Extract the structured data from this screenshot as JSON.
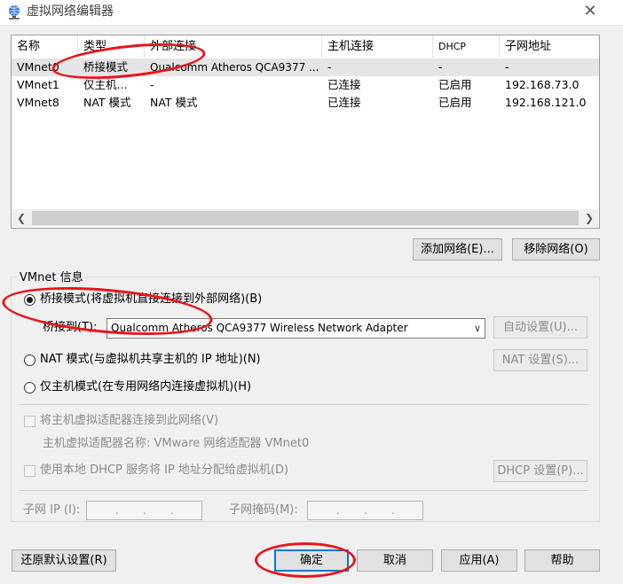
{
  "window": {
    "title": "虚拟网络编辑器",
    "close_glyph": "✕"
  },
  "table": {
    "columns": [
      "名称",
      "类型",
      "外部连接",
      "主机连接",
      "DHCP",
      "子网地址"
    ],
    "rows": [
      [
        "VMnet0",
        "桥接模式",
        "Qualcomm Atheros QCA9377 ...",
        "-",
        "-",
        "-"
      ],
      [
        "VMnet1",
        "仅主机...",
        "-",
        "已连接",
        "已启用",
        "192.168.73.0"
      ],
      [
        "VMnet8",
        "NAT 模式",
        "NAT 模式",
        "已连接",
        "已启用",
        "192.168.121.0"
      ]
    ],
    "selected_row": 0
  },
  "list_buttons": {
    "add": "添加网络(E)...",
    "remove": "移除网络(O)"
  },
  "vmnet_info": {
    "label": "VMnet 信息",
    "bridge_radio": "桥接模式(将虚拟机直接连接到外部网络)(B)",
    "bridge_to_label": "桥接到(T):",
    "bridge_adapter": "Qualcomm Atheros QCA9377 Wireless Network Adapter",
    "auto_settings": "自动设置(U)...",
    "nat_radio": "NAT 模式(与虚拟机共享主机的 IP 地址)(N)",
    "nat_settings": "NAT 设置(S)...",
    "hostonly_radio": "仅主机模式(在专用网络内连接虚拟机)(H)",
    "connect_adapter": "将主机虚拟适配器连接到此网络(V)",
    "adapter_name": "主机虚拟适配器名称: VMware 网络适配器 VMnet0",
    "use_dhcp": "使用本地 DHCP 服务将 IP 地址分配给虚拟机(D)",
    "dhcp_settings": "DHCP 设置(P)...",
    "subnet_ip_label": "子网 IP (I):",
    "subnet_mask_label": "子网掩码(M):",
    "ip_dot": "."
  },
  "footer": {
    "restore": "还原默认设置(R)",
    "ok": "确定",
    "cancel": "取消",
    "apply": "应用(A)",
    "help": "帮助"
  },
  "colors": {
    "annotation": "#e8141c",
    "accent": "#0078d7"
  }
}
